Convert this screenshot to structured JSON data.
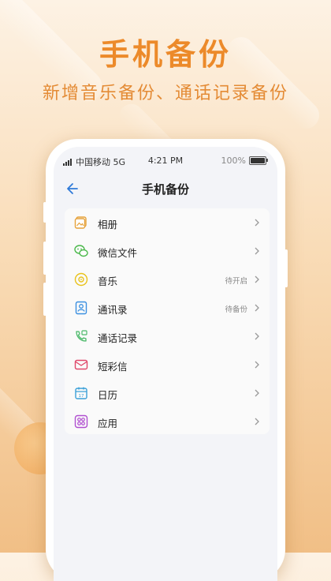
{
  "promo": {
    "title": "手机备份",
    "subtitle": "新增音乐备份、通话记录备份"
  },
  "status_bar": {
    "carrier": "中国移动 5G",
    "time": "4:21 PM",
    "battery_percent": "100%"
  },
  "header": {
    "title": "手机备份"
  },
  "colors": {
    "accent_orange": "#ec8a2a",
    "back_arrow_blue": "#2f7ad8"
  },
  "backup_items": [
    {
      "label": "相册",
      "status": "",
      "icon": "album-icon"
    },
    {
      "label": "微信文件",
      "status": "",
      "icon": "wechat-icon"
    },
    {
      "label": "音乐",
      "status": "待开启",
      "icon": "music-icon"
    },
    {
      "label": "通讯录",
      "status": "待备份",
      "icon": "contacts-icon"
    },
    {
      "label": "通话记录",
      "status": "",
      "icon": "call-log-icon"
    },
    {
      "label": "短彩信",
      "status": "",
      "icon": "sms-icon"
    },
    {
      "label": "日历",
      "status": "",
      "icon": "calendar-icon"
    },
    {
      "label": "应用",
      "status": "",
      "icon": "apps-icon"
    }
  ]
}
